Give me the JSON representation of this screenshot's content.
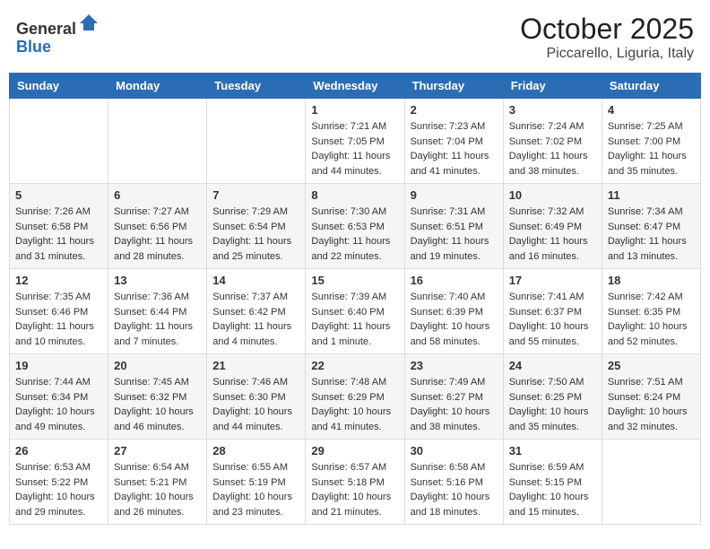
{
  "header": {
    "logo_line1": "General",
    "logo_line2": "Blue",
    "title": "October 2025",
    "subtitle": "Piccarello, Liguria, Italy"
  },
  "calendar": {
    "days_of_week": [
      "Sunday",
      "Monday",
      "Tuesday",
      "Wednesday",
      "Thursday",
      "Friday",
      "Saturday"
    ],
    "weeks": [
      [
        {
          "day": "",
          "sunrise": "",
          "sunset": "",
          "daylight": ""
        },
        {
          "day": "",
          "sunrise": "",
          "sunset": "",
          "daylight": ""
        },
        {
          "day": "",
          "sunrise": "",
          "sunset": "",
          "daylight": ""
        },
        {
          "day": "1",
          "sunrise": "Sunrise: 7:21 AM",
          "sunset": "Sunset: 7:05 PM",
          "daylight": "Daylight: 11 hours and 44 minutes."
        },
        {
          "day": "2",
          "sunrise": "Sunrise: 7:23 AM",
          "sunset": "Sunset: 7:04 PM",
          "daylight": "Daylight: 11 hours and 41 minutes."
        },
        {
          "day": "3",
          "sunrise": "Sunrise: 7:24 AM",
          "sunset": "Sunset: 7:02 PM",
          "daylight": "Daylight: 11 hours and 38 minutes."
        },
        {
          "day": "4",
          "sunrise": "Sunrise: 7:25 AM",
          "sunset": "Sunset: 7:00 PM",
          "daylight": "Daylight: 11 hours and 35 minutes."
        }
      ],
      [
        {
          "day": "5",
          "sunrise": "Sunrise: 7:26 AM",
          "sunset": "Sunset: 6:58 PM",
          "daylight": "Daylight: 11 hours and 31 minutes."
        },
        {
          "day": "6",
          "sunrise": "Sunrise: 7:27 AM",
          "sunset": "Sunset: 6:56 PM",
          "daylight": "Daylight: 11 hours and 28 minutes."
        },
        {
          "day": "7",
          "sunrise": "Sunrise: 7:29 AM",
          "sunset": "Sunset: 6:54 PM",
          "daylight": "Daylight: 11 hours and 25 minutes."
        },
        {
          "day": "8",
          "sunrise": "Sunrise: 7:30 AM",
          "sunset": "Sunset: 6:53 PM",
          "daylight": "Daylight: 11 hours and 22 minutes."
        },
        {
          "day": "9",
          "sunrise": "Sunrise: 7:31 AM",
          "sunset": "Sunset: 6:51 PM",
          "daylight": "Daylight: 11 hours and 19 minutes."
        },
        {
          "day": "10",
          "sunrise": "Sunrise: 7:32 AM",
          "sunset": "Sunset: 6:49 PM",
          "daylight": "Daylight: 11 hours and 16 minutes."
        },
        {
          "day": "11",
          "sunrise": "Sunrise: 7:34 AM",
          "sunset": "Sunset: 6:47 PM",
          "daylight": "Daylight: 11 hours and 13 minutes."
        }
      ],
      [
        {
          "day": "12",
          "sunrise": "Sunrise: 7:35 AM",
          "sunset": "Sunset: 6:46 PM",
          "daylight": "Daylight: 11 hours and 10 minutes."
        },
        {
          "day": "13",
          "sunrise": "Sunrise: 7:36 AM",
          "sunset": "Sunset: 6:44 PM",
          "daylight": "Daylight: 11 hours and 7 minutes."
        },
        {
          "day": "14",
          "sunrise": "Sunrise: 7:37 AM",
          "sunset": "Sunset: 6:42 PM",
          "daylight": "Daylight: 11 hours and 4 minutes."
        },
        {
          "day": "15",
          "sunrise": "Sunrise: 7:39 AM",
          "sunset": "Sunset: 6:40 PM",
          "daylight": "Daylight: 11 hours and 1 minute."
        },
        {
          "day": "16",
          "sunrise": "Sunrise: 7:40 AM",
          "sunset": "Sunset: 6:39 PM",
          "daylight": "Daylight: 10 hours and 58 minutes."
        },
        {
          "day": "17",
          "sunrise": "Sunrise: 7:41 AM",
          "sunset": "Sunset: 6:37 PM",
          "daylight": "Daylight: 10 hours and 55 minutes."
        },
        {
          "day": "18",
          "sunrise": "Sunrise: 7:42 AM",
          "sunset": "Sunset: 6:35 PM",
          "daylight": "Daylight: 10 hours and 52 minutes."
        }
      ],
      [
        {
          "day": "19",
          "sunrise": "Sunrise: 7:44 AM",
          "sunset": "Sunset: 6:34 PM",
          "daylight": "Daylight: 10 hours and 49 minutes."
        },
        {
          "day": "20",
          "sunrise": "Sunrise: 7:45 AM",
          "sunset": "Sunset: 6:32 PM",
          "daylight": "Daylight: 10 hours and 46 minutes."
        },
        {
          "day": "21",
          "sunrise": "Sunrise: 7:46 AM",
          "sunset": "Sunset: 6:30 PM",
          "daylight": "Daylight: 10 hours and 44 minutes."
        },
        {
          "day": "22",
          "sunrise": "Sunrise: 7:48 AM",
          "sunset": "Sunset: 6:29 PM",
          "daylight": "Daylight: 10 hours and 41 minutes."
        },
        {
          "day": "23",
          "sunrise": "Sunrise: 7:49 AM",
          "sunset": "Sunset: 6:27 PM",
          "daylight": "Daylight: 10 hours and 38 minutes."
        },
        {
          "day": "24",
          "sunrise": "Sunrise: 7:50 AM",
          "sunset": "Sunset: 6:25 PM",
          "daylight": "Daylight: 10 hours and 35 minutes."
        },
        {
          "day": "25",
          "sunrise": "Sunrise: 7:51 AM",
          "sunset": "Sunset: 6:24 PM",
          "daylight": "Daylight: 10 hours and 32 minutes."
        }
      ],
      [
        {
          "day": "26",
          "sunrise": "Sunrise: 6:53 AM",
          "sunset": "Sunset: 5:22 PM",
          "daylight": "Daylight: 10 hours and 29 minutes."
        },
        {
          "day": "27",
          "sunrise": "Sunrise: 6:54 AM",
          "sunset": "Sunset: 5:21 PM",
          "daylight": "Daylight: 10 hours and 26 minutes."
        },
        {
          "day": "28",
          "sunrise": "Sunrise: 6:55 AM",
          "sunset": "Sunset: 5:19 PM",
          "daylight": "Daylight: 10 hours and 23 minutes."
        },
        {
          "day": "29",
          "sunrise": "Sunrise: 6:57 AM",
          "sunset": "Sunset: 5:18 PM",
          "daylight": "Daylight: 10 hours and 21 minutes."
        },
        {
          "day": "30",
          "sunrise": "Sunrise: 6:58 AM",
          "sunset": "Sunset: 5:16 PM",
          "daylight": "Daylight: 10 hours and 18 minutes."
        },
        {
          "day": "31",
          "sunrise": "Sunrise: 6:59 AM",
          "sunset": "Sunset: 5:15 PM",
          "daylight": "Daylight: 10 hours and 15 minutes."
        },
        {
          "day": "",
          "sunrise": "",
          "sunset": "",
          "daylight": ""
        }
      ]
    ]
  }
}
